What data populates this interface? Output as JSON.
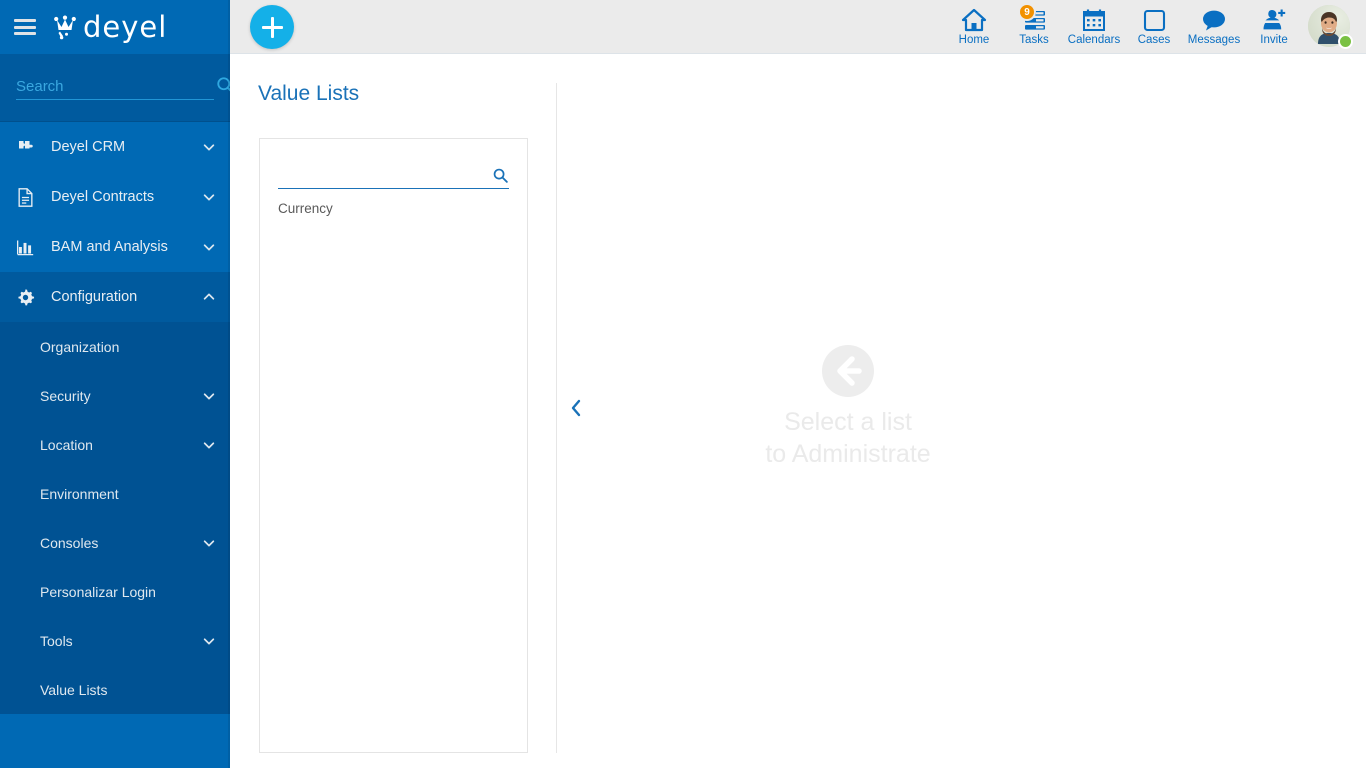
{
  "brand": {
    "name": "deyel",
    "logo_icon": "deyel-crown-icon"
  },
  "sidebar": {
    "menu_icon": "hamburger-icon",
    "search": {
      "placeholder": "Search",
      "value": "",
      "icon": "search-icon"
    },
    "items": [
      {
        "label": "Deyel CRM",
        "icon": "puzzle-icon",
        "chevron": "chevron-down-icon",
        "expanded": false
      },
      {
        "label": "Deyel Contracts",
        "icon": "document-icon",
        "chevron": "chevron-down-icon",
        "expanded": false
      },
      {
        "label": "BAM and Analysis",
        "icon": "bar-chart-icon",
        "chevron": "chevron-down-icon",
        "expanded": false
      },
      {
        "label": "Configuration",
        "icon": "gear-icon",
        "chevron": "chevron-up-icon",
        "expanded": true
      }
    ],
    "submenu": [
      {
        "label": "Organization",
        "chevron": ""
      },
      {
        "label": "Security",
        "chevron": "chevron-down-icon"
      },
      {
        "label": "Location",
        "chevron": "chevron-down-icon"
      },
      {
        "label": "Environment",
        "chevron": ""
      },
      {
        "label": "Consoles",
        "chevron": "chevron-down-icon"
      },
      {
        "label": "Personalizar Login",
        "chevron": ""
      },
      {
        "label": "Tools",
        "chevron": "chevron-down-icon"
      },
      {
        "label": "Value Lists",
        "chevron": ""
      }
    ]
  },
  "topbar": {
    "add_button": {
      "label": "+",
      "icon": "plus-icon"
    },
    "nav": [
      {
        "label": "Home",
        "icon": "home-icon",
        "badge": ""
      },
      {
        "label": "Tasks",
        "icon": "tasks-icon",
        "badge": "9"
      },
      {
        "label": "Calendars",
        "icon": "calendar-icon",
        "badge": ""
      },
      {
        "label": "Cases",
        "icon": "case-square-icon",
        "badge": ""
      },
      {
        "label": "Messages",
        "icon": "chat-bubble-icon",
        "badge": ""
      },
      {
        "label": "Invite",
        "icon": "person-add-icon",
        "badge": ""
      }
    ],
    "avatar": {
      "icon": "user-avatar",
      "status": "online"
    }
  },
  "main": {
    "page_title": "Value Lists",
    "list_panel": {
      "search": {
        "placeholder": "",
        "value": "",
        "icon": "search-icon"
      },
      "rows": [
        {
          "label": "Currency"
        }
      ]
    },
    "collapse_button": {
      "icon": "chevron-left-icon"
    },
    "empty_state": {
      "icon": "arrow-left-circle-icon",
      "line1": "Select a list",
      "line2": "to Administrate"
    }
  },
  "colors": {
    "brand_blue": "#0069b4",
    "sidebar_dark": "#005293",
    "accent_cyan": "#14b0e8",
    "badge_orange": "#f29100",
    "status_green": "#7ac143",
    "title_blue": "#1a72b8",
    "topbar_gray": "#ebebeb"
  }
}
